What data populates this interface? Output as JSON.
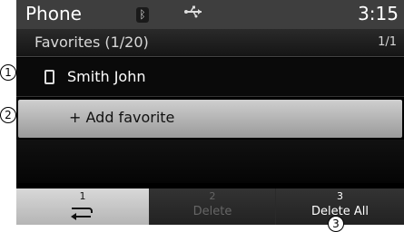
{
  "statusbar": {
    "app_title": "Phone",
    "bluetooth_glyph": "ᛒ",
    "usb_glyph": "⭠",
    "time": "3:15"
  },
  "header": {
    "title": "Favorites (1/20)",
    "page": "1/1"
  },
  "list": {
    "contact_name": "Smith John",
    "add_label": "+ Add favorite"
  },
  "softkeys": [
    {
      "num": "1",
      "label": ""
    },
    {
      "num": "2",
      "label": "Delete"
    },
    {
      "num": "3",
      "label": "Delete All"
    }
  ],
  "callouts": {
    "c1": "1",
    "c2": "2",
    "c3": "3"
  },
  "colors": {
    "statusbar": "#3e3e3e",
    "selected_row": "#cfcfcf",
    "active_softkey": "#d8d8d8"
  },
  "icons": {
    "bluetooth": "bluetooth-icon",
    "usb": "usb-icon",
    "phone": "phone-icon",
    "back": "back-icon"
  }
}
